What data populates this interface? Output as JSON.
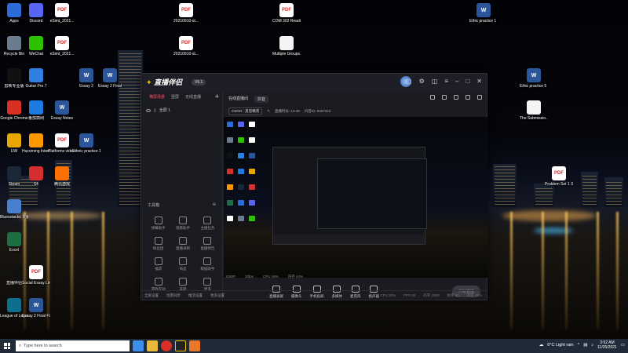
{
  "desktop": {
    "icons": [
      {
        "label": "Apps",
        "type": "app",
        "color": "#2d6bd8"
      },
      {
        "label": "Discord",
        "type": "app",
        "color": "#5865f2"
      },
      {
        "label": "eSimt_2021...",
        "type": "pdf"
      },
      {
        "label": "Recycle Bin",
        "type": "app",
        "color": "#6b7c8f"
      },
      {
        "label": "WeChat",
        "type": "app",
        "color": "#2dc100"
      },
      {
        "label": "eSimt_2021...",
        "type": "pdf"
      },
      {
        "label": "剪映专业版",
        "type": "app",
        "color": "#111111"
      },
      {
        "label": "Guitar Pro 7",
        "type": "app",
        "color": "#2d7fe0"
      },
      {
        "label": "Essay 2",
        "type": "word"
      },
      {
        "label": "Essay 2 Final",
        "type": "word"
      },
      {
        "label": "Google Chrome",
        "type": "app",
        "color": "#d93025"
      },
      {
        "label": "番茄搞网",
        "type": "app",
        "color": "#1c7ae0"
      },
      {
        "label": "Essay Notes",
        "type": "word"
      },
      {
        "label": "UW",
        "type": "app",
        "color": "#e8a600"
      },
      {
        "label": "Hucoming Interne...",
        "type": "app",
        "color": "#ff9800"
      },
      {
        "label": "Platforms videos doc...",
        "type": "pdf"
      },
      {
        "label": "Ethnic practice 1...",
        "type": "word"
      },
      {
        "label": "Steam",
        "type": "app",
        "color": "#1b2838"
      },
      {
        "label": "64",
        "type": "app",
        "color": "#d32f2f"
      },
      {
        "label": "腾讯游戏",
        "type": "app",
        "color": "#ff6f00"
      },
      {
        "label": "Bluesstacks 天籁...",
        "type": "app",
        "color": "#4a7fd0"
      },
      {
        "label": "Excel",
        "type": "app",
        "color": "#1d6f42"
      },
      {
        "label": "直播伴侣",
        "type": "app",
        "color": "#111111"
      },
      {
        "label": "Social Essay Lines...",
        "type": "pdf"
      },
      {
        "label": "League of Legends",
        "type": "app",
        "color": "#0d6f8a"
      },
      {
        "label": "Essay 2 Final Final",
        "type": "word"
      },
      {
        "label": "20210910-st...",
        "type": "pdf"
      },
      {
        "label": "20210910-st...",
        "type": "pdf"
      },
      {
        "label": "COM 302 Reading Re...",
        "type": "pdf"
      },
      {
        "label": "Multiple Groups...",
        "type": "blank"
      },
      {
        "label": "Ethic practice 1 Final",
        "type": "word"
      },
      {
        "label": "Ethic practice 5 111",
        "type": "word"
      },
      {
        "label": "The Submissio...",
        "type": "blank"
      },
      {
        "label": "Problem Set 1 Solved",
        "type": "pdf"
      }
    ]
  },
  "app": {
    "logo_text": "直播伴侣",
    "version": "V6.1",
    "left_tabs": [
      "横屏场景",
      "竖屏",
      "无线直播"
    ],
    "add_icon": "plus-icon",
    "scene_label": "全屏 1",
    "tools_title": "工具箱",
    "tools": [
      "弹幕助手",
      "观看助手",
      "主播任务",
      "粉丝团",
      "直播录制",
      "直播预告",
      "福袋",
      "商品",
      "数据助手",
      "游戏互动",
      "美颜",
      "更多"
    ],
    "stream_tabs": [
      "在线直播间",
      "抖音"
    ],
    "category_select": "CSGO - 反恐精英",
    "stream_title": "直播时长: 13:48",
    "viewer_info": "抖音ID: 84573x3",
    "bottom_tools": [
      "直播录屏",
      "摄像头",
      "手机投屏",
      "多媒体",
      "麦克风",
      "扬声器"
    ],
    "go_live": "开始直播",
    "bottom_info": [
      "全屏设置",
      "场景同步",
      "推流设置",
      "更多设置"
    ],
    "stats": [
      "CPU 22%",
      "FPS 60",
      "码率 2000",
      "帧率 60",
      "内存 45%"
    ],
    "status_row": [
      "1080P",
      "30fps",
      "CPU 19%",
      "内存 44%"
    ]
  },
  "taskbar": {
    "search_placeholder": "Type here to search",
    "weather": "6°C Light rain",
    "time": "3:52 AM",
    "date": "11/25/2021"
  }
}
